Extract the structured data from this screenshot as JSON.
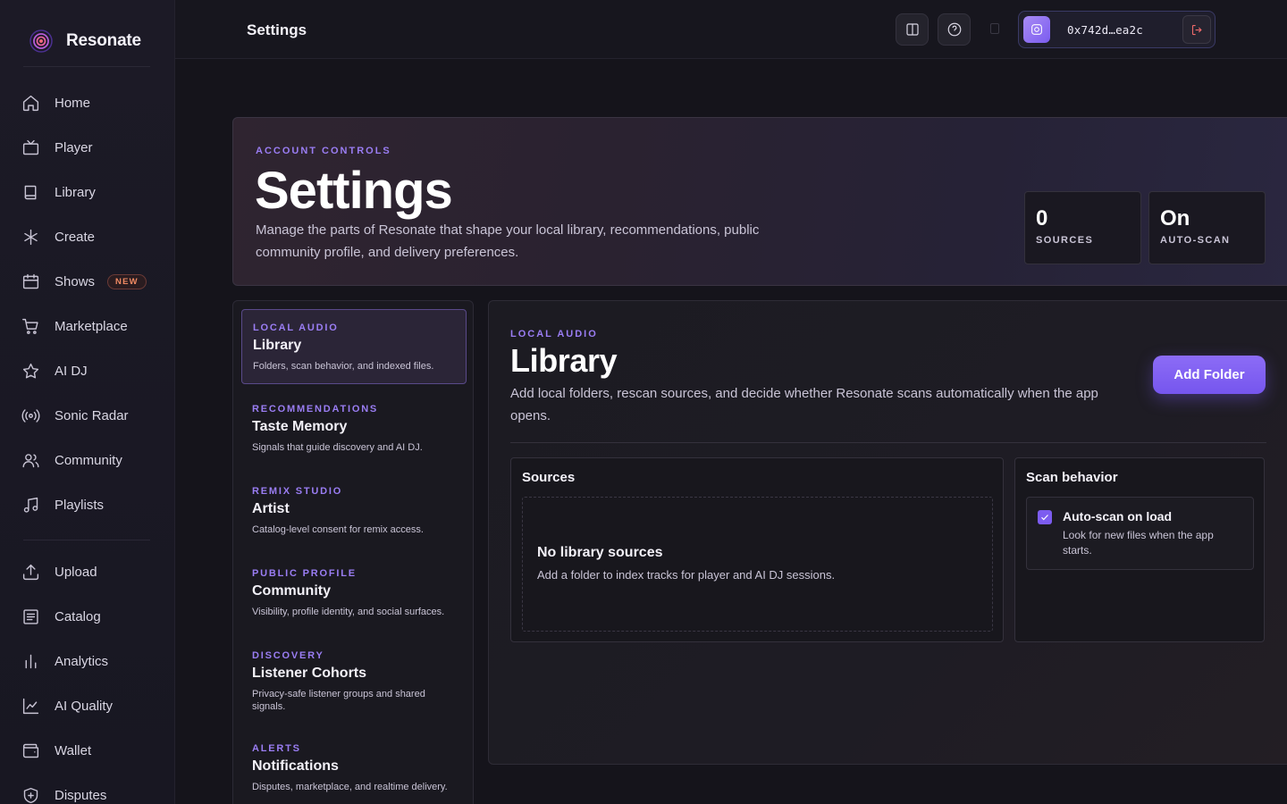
{
  "app": {
    "name": "Resonate"
  },
  "sidebar": {
    "items": [
      {
        "label": "Home",
        "icon": "home-icon"
      },
      {
        "label": "Player",
        "icon": "tv-icon"
      },
      {
        "label": "Library",
        "icon": "book-icon"
      },
      {
        "label": "Create",
        "icon": "asterisk-icon"
      },
      {
        "label": "Shows",
        "icon": "calendar-icon",
        "badge": "NEW"
      },
      {
        "label": "Marketplace",
        "icon": "cart-icon"
      },
      {
        "label": "AI DJ",
        "icon": "star-icon"
      },
      {
        "label": "Sonic Radar",
        "icon": "radar-icon"
      },
      {
        "label": "Community",
        "icon": "users-icon"
      },
      {
        "label": "Playlists",
        "icon": "music-note-icon"
      },
      {
        "label": "Upload",
        "icon": "upload-icon"
      },
      {
        "label": "Catalog",
        "icon": "list-icon"
      },
      {
        "label": "Analytics",
        "icon": "bar-chart-icon"
      },
      {
        "label": "AI Quality",
        "icon": "line-chart-icon"
      },
      {
        "label": "Wallet",
        "icon": "wallet-icon"
      },
      {
        "label": "Disputes",
        "icon": "shield-plus-icon"
      }
    ]
  },
  "topbar": {
    "title": "Settings",
    "wallet_address": "0x742d…ea2c"
  },
  "hero": {
    "eyebrow": "ACCOUNT CONTROLS",
    "title": "Settings",
    "description": "Manage the parts of Resonate that shape your local library, recommendations, public community profile, and delivery preferences.",
    "stats": [
      {
        "value": "0",
        "label": "SOURCES"
      },
      {
        "value": "On",
        "label": "AUTO-SCAN"
      }
    ]
  },
  "settings_nav": [
    {
      "eyebrow": "LOCAL AUDIO",
      "title": "Library",
      "desc": "Folders, scan behavior, and indexed files.",
      "active": true
    },
    {
      "eyebrow": "RECOMMENDATIONS",
      "title": "Taste Memory",
      "desc": "Signals that guide discovery and AI DJ."
    },
    {
      "eyebrow": "REMIX STUDIO",
      "title": "Artist",
      "desc": "Catalog-level consent for remix access."
    },
    {
      "eyebrow": "PUBLIC PROFILE",
      "title": "Community",
      "desc": "Visibility, profile identity, and social surfaces."
    },
    {
      "eyebrow": "DISCOVERY",
      "title": "Listener Cohorts",
      "desc": "Privacy-safe listener groups and shared signals."
    },
    {
      "eyebrow": "ALERTS",
      "title": "Notifications",
      "desc": "Disputes, marketplace, and realtime delivery."
    }
  ],
  "panel": {
    "eyebrow": "LOCAL AUDIO",
    "title": "Library",
    "description": "Add local folders, rescan sources, and decide whether Resonate scans automatically when the app opens.",
    "add_button": "Add Folder",
    "sources": {
      "title": "Sources",
      "empty_title": "No library sources",
      "empty_desc": "Add a folder to index tracks for player and AI DJ sessions."
    },
    "scan": {
      "title": "Scan behavior",
      "option_title": "Auto-scan on load",
      "option_desc": "Look for new files when the app starts.",
      "checked": true
    }
  },
  "colors": {
    "accent": "#7c5cf0",
    "eyebrow": "#9a7df3",
    "badge": "#f08a63",
    "danger": "#ef6a6a"
  }
}
